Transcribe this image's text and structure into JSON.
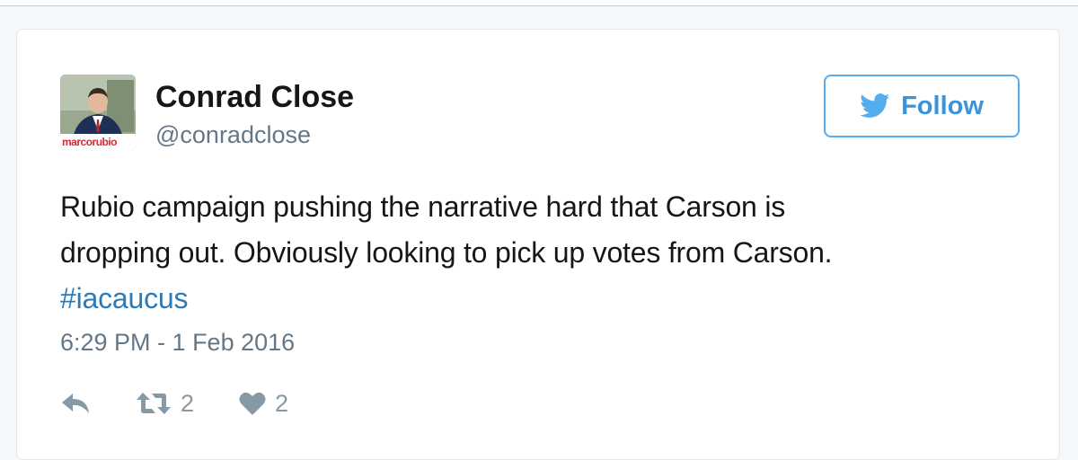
{
  "tweet": {
    "author": {
      "name": "Conrad Close",
      "handle": "@conradclose",
      "avatar_overlay_text": "marcorubio"
    },
    "follow_button": {
      "label": "Follow"
    },
    "text_lines": [
      "Rubio campaign pushing the narrative hard that Carson is",
      "dropping out. Obviously looking to pick up votes from Carson."
    ],
    "hashtag": "#iacaucus",
    "timestamp": "6:29 PM - 1 Feb 2016",
    "actions": {
      "retweet_count": "2",
      "like_count": "2"
    }
  },
  "colors": {
    "link": "#2b7bb9",
    "follow_blue": "#55acee",
    "text_primary": "#14171a",
    "text_secondary": "#657786",
    "action_icon": "#8899a6"
  },
  "icons": {
    "follow": "twitter-bird-icon",
    "reply": "reply-icon",
    "retweet": "retweet-icon",
    "like": "heart-icon"
  }
}
